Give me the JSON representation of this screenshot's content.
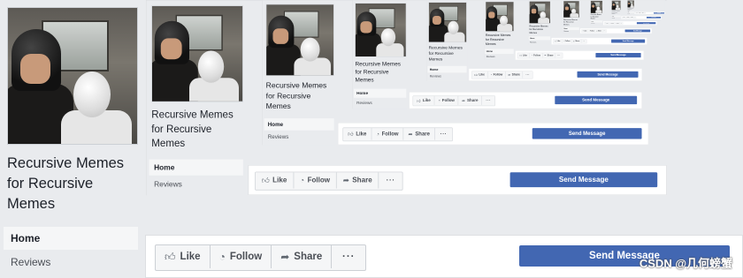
{
  "page": {
    "name": "Recursive Memes\nfor Recursive\nMemes"
  },
  "nav": {
    "home": "Home",
    "reviews": "Reviews"
  },
  "actions": {
    "like": "Like",
    "follow": "Follow",
    "share": "Share",
    "more": "···",
    "send_message": "Send Message"
  },
  "icons": {
    "like": "thumbs-up-icon",
    "follow": "rss-icon",
    "share": "share-arrow-icon",
    "more": "ellipsis-icon"
  },
  "colors": {
    "brand_blue": "#4267b2",
    "background": "#e9ebee"
  },
  "watermark": "CSDN @几何螃蟹"
}
